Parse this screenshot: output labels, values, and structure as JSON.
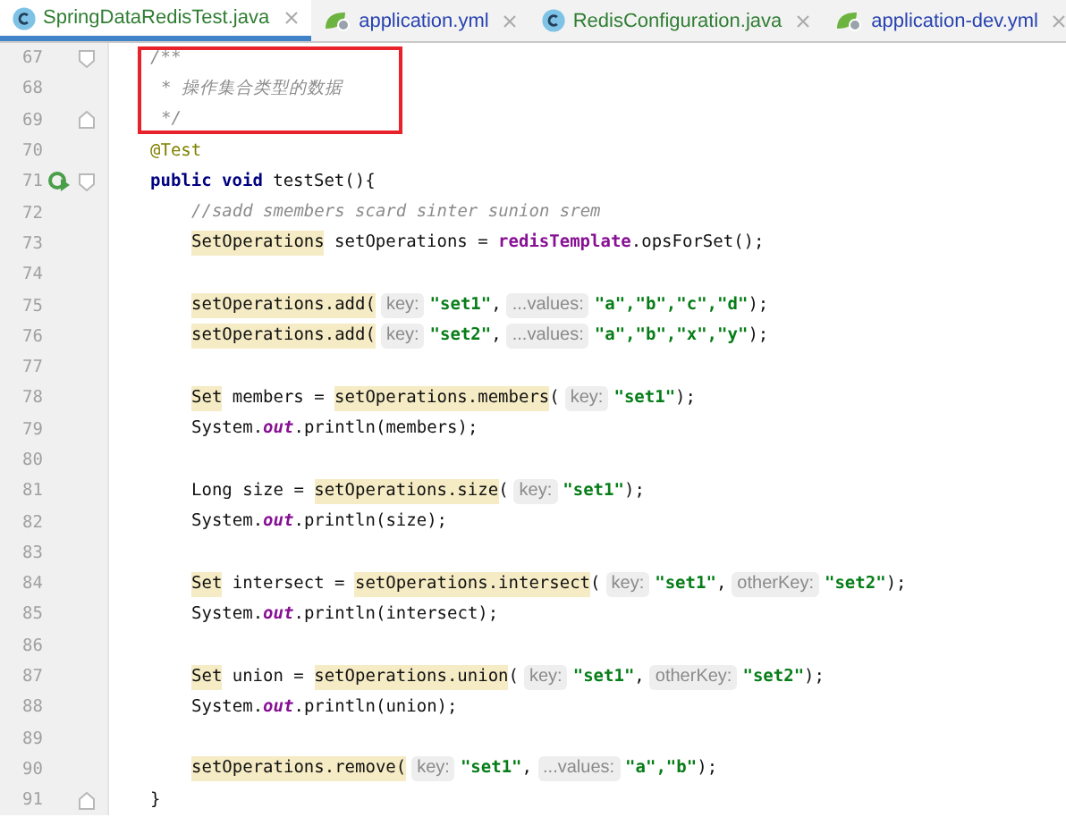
{
  "tabs": [
    {
      "label": "SpringDataRedisTest.java",
      "kind": "java",
      "selected": true,
      "color": "#2f7d32"
    },
    {
      "label": "application.yml",
      "kind": "yml",
      "selected": false,
      "color": "#2843b0"
    },
    {
      "label": "RedisConfiguration.java",
      "kind": "java",
      "selected": false,
      "color": "#2f7d32"
    },
    {
      "label": "application-dev.yml",
      "kind": "yml",
      "selected": false,
      "color": "#2843b0"
    }
  ],
  "lines": [
    {
      "number": "67",
      "kind": "code",
      "fold_start": true,
      "tokens": [
        {
          "kind": "comment",
          "text": "/**"
        }
      ]
    },
    {
      "number": "68",
      "kind": "doc",
      "tokens": [
        {
          "kind": "comment",
          "text": "* 操作集合类型的数据"
        }
      ]
    },
    {
      "number": "69",
      "kind": "doc",
      "fold_end": true,
      "tokens": [
        {
          "kind": "comment",
          "text": "*/"
        }
      ]
    },
    {
      "number": "70",
      "kind": "code",
      "tokens": [
        {
          "kind": "annotation",
          "text": "@Test"
        }
      ]
    },
    {
      "number": "71",
      "kind": "code",
      "run": true,
      "fold_start": true,
      "tokens": [
        {
          "kind": "keyword",
          "text": "public void"
        },
        {
          "kind": "plain",
          "text": "testSet(){"
        }
      ],
      "children": [
        {
          "number": "72",
          "kind": "code",
          "tokens": [
            {
              "kind": "comment",
              "text": "//sadd smembers scard sinter sunion srem"
            }
          ]
        },
        {
          "number": "73",
          "kind": "code",
          "tokens": [
            {
              "kind": "mark",
              "text": "SetOperations"
            },
            {
              "kind": "plain",
              "text": "setOperations ="
            },
            {
              "kind": "field",
              "text": "redisTemplate"
            },
            {
              "kind": "plain",
              "text": ".opsForSet();"
            }
          ]
        },
        {
          "number": "74",
          "kind": "code"
        },
        {
          "number": "75",
          "kind": "code",
          "tokens": [
            {
              "kind": "mark",
              "text": "setOperations.add("
            },
            {
              "kind": "hint",
              "text": "key:"
            },
            {
              "kind": "string",
              "text": "\"set1\""
            },
            {
              "kind": "plain",
              "text": ","
            },
            {
              "kind": "hint",
              "text": "...values:"
            },
            {
              "kind": "string",
              "text": "\"a\",\"b\",\"c\",\"d\""
            },
            {
              "kind": "plain",
              "text": ");"
            }
          ]
        },
        {
          "number": "76",
          "kind": "code",
          "tokens": [
            {
              "kind": "mark",
              "text": "setOperations.add("
            },
            {
              "kind": "hint",
              "text": "key:"
            },
            {
              "kind": "string",
              "text": "\"set2\""
            },
            {
              "kind": "plain",
              "text": ","
            },
            {
              "kind": "hint",
              "text": "...values:"
            },
            {
              "kind": "string",
              "text": "\"a\",\"b\",\"x\",\"y\""
            },
            {
              "kind": "plain",
              "text": ");"
            }
          ]
        },
        {
          "number": "77",
          "kind": "code"
        },
        {
          "number": "78",
          "kind": "code",
          "tokens": [
            {
              "kind": "mark",
              "text": "Set"
            },
            {
              "kind": "plain",
              "text": "members ="
            },
            {
              "kind": "mark",
              "text": "setOperations.members"
            },
            {
              "kind": "plain",
              "text": "("
            },
            {
              "kind": "hint",
              "text": "key:"
            },
            {
              "kind": "string",
              "text": "\"set1\""
            },
            {
              "kind": "plain",
              "text": ");"
            }
          ]
        },
        {
          "number": "79",
          "kind": "code",
          "tokens": [
            {
              "kind": "plain",
              "text": "System."
            },
            {
              "kind": "static",
              "text": "out"
            },
            {
              "kind": "plain",
              "text": ".println(members);"
            }
          ]
        },
        {
          "number": "80",
          "kind": "code"
        },
        {
          "number": "81",
          "kind": "code",
          "tokens": [
            {
              "kind": "plain",
              "text": "Long size ="
            },
            {
              "kind": "mark",
              "text": "setOperations.size"
            },
            {
              "kind": "plain",
              "text": "("
            },
            {
              "kind": "hint",
              "text": "key:"
            },
            {
              "kind": "string",
              "text": "\"set1\""
            },
            {
              "kind": "plain",
              "text": ");"
            }
          ]
        },
        {
          "number": "82",
          "kind": "code",
          "tokens": [
            {
              "kind": "plain",
              "text": "System."
            },
            {
              "kind": "static",
              "text": "out"
            },
            {
              "kind": "plain",
              "text": ".println(size);"
            }
          ]
        },
        {
          "number": "83",
          "kind": "code"
        },
        {
          "number": "84",
          "kind": "code",
          "tokens": [
            {
              "kind": "mark",
              "text": "Set"
            },
            {
              "kind": "plain",
              "text": "intersect ="
            },
            {
              "kind": "mark",
              "text": "setOperations.intersect"
            },
            {
              "kind": "plain",
              "text": "("
            },
            {
              "kind": "hint",
              "text": "key:"
            },
            {
              "kind": "string",
              "text": "\"set1\""
            },
            {
              "kind": "plain",
              "text": ","
            },
            {
              "kind": "hint",
              "text": "otherKey:"
            },
            {
              "kind": "string",
              "text": "\"set2\""
            },
            {
              "kind": "plain",
              "text": ");"
            }
          ]
        },
        {
          "number": "85",
          "kind": "code",
          "tokens": [
            {
              "kind": "plain",
              "text": "System."
            },
            {
              "kind": "static",
              "text": "out"
            },
            {
              "kind": "plain",
              "text": ".println(intersect);"
            }
          ]
        },
        {
          "number": "86",
          "kind": "code"
        },
        {
          "number": "87",
          "kind": "code",
          "tokens": [
            {
              "kind": "mark",
              "text": "Set"
            },
            {
              "kind": "plain",
              "text": "union ="
            },
            {
              "kind": "mark",
              "text": "setOperations.union"
            },
            {
              "kind": "plain",
              "text": "("
            },
            {
              "kind": "hint",
              "text": "key:"
            },
            {
              "kind": "string",
              "text": "\"set1\""
            },
            {
              "kind": "plain",
              "text": ","
            },
            {
              "kind": "hint",
              "text": "otherKey:"
            },
            {
              "kind": "string",
              "text": "\"set2\""
            },
            {
              "kind": "plain",
              "text": ");"
            }
          ]
        },
        {
          "number": "88",
          "kind": "code",
          "tokens": [
            {
              "kind": "plain",
              "text": "System."
            },
            {
              "kind": "static",
              "text": "out"
            },
            {
              "kind": "plain",
              "text": ".println(union);"
            }
          ]
        },
        {
          "number": "89",
          "kind": "code"
        },
        {
          "number": "90",
          "kind": "code",
          "tokens": [
            {
              "kind": "mark",
              "text": "setOperations.remove("
            },
            {
              "kind": "hint",
              "text": "key:"
            },
            {
              "kind": "string",
              "text": "\"set1\""
            },
            {
              "kind": "plain",
              "text": ","
            },
            {
              "kind": "hint",
              "text": "...values:"
            },
            {
              "kind": "string",
              "text": "\"a\",\"b\""
            },
            {
              "kind": "plain",
              "text": ");"
            }
          ]
        }
      ]
    },
    {
      "number": "91",
      "kind": "code",
      "fold_end": true,
      "tokens": [
        {
          "kind": "plain",
          "text": "}"
        }
      ]
    }
  ]
}
